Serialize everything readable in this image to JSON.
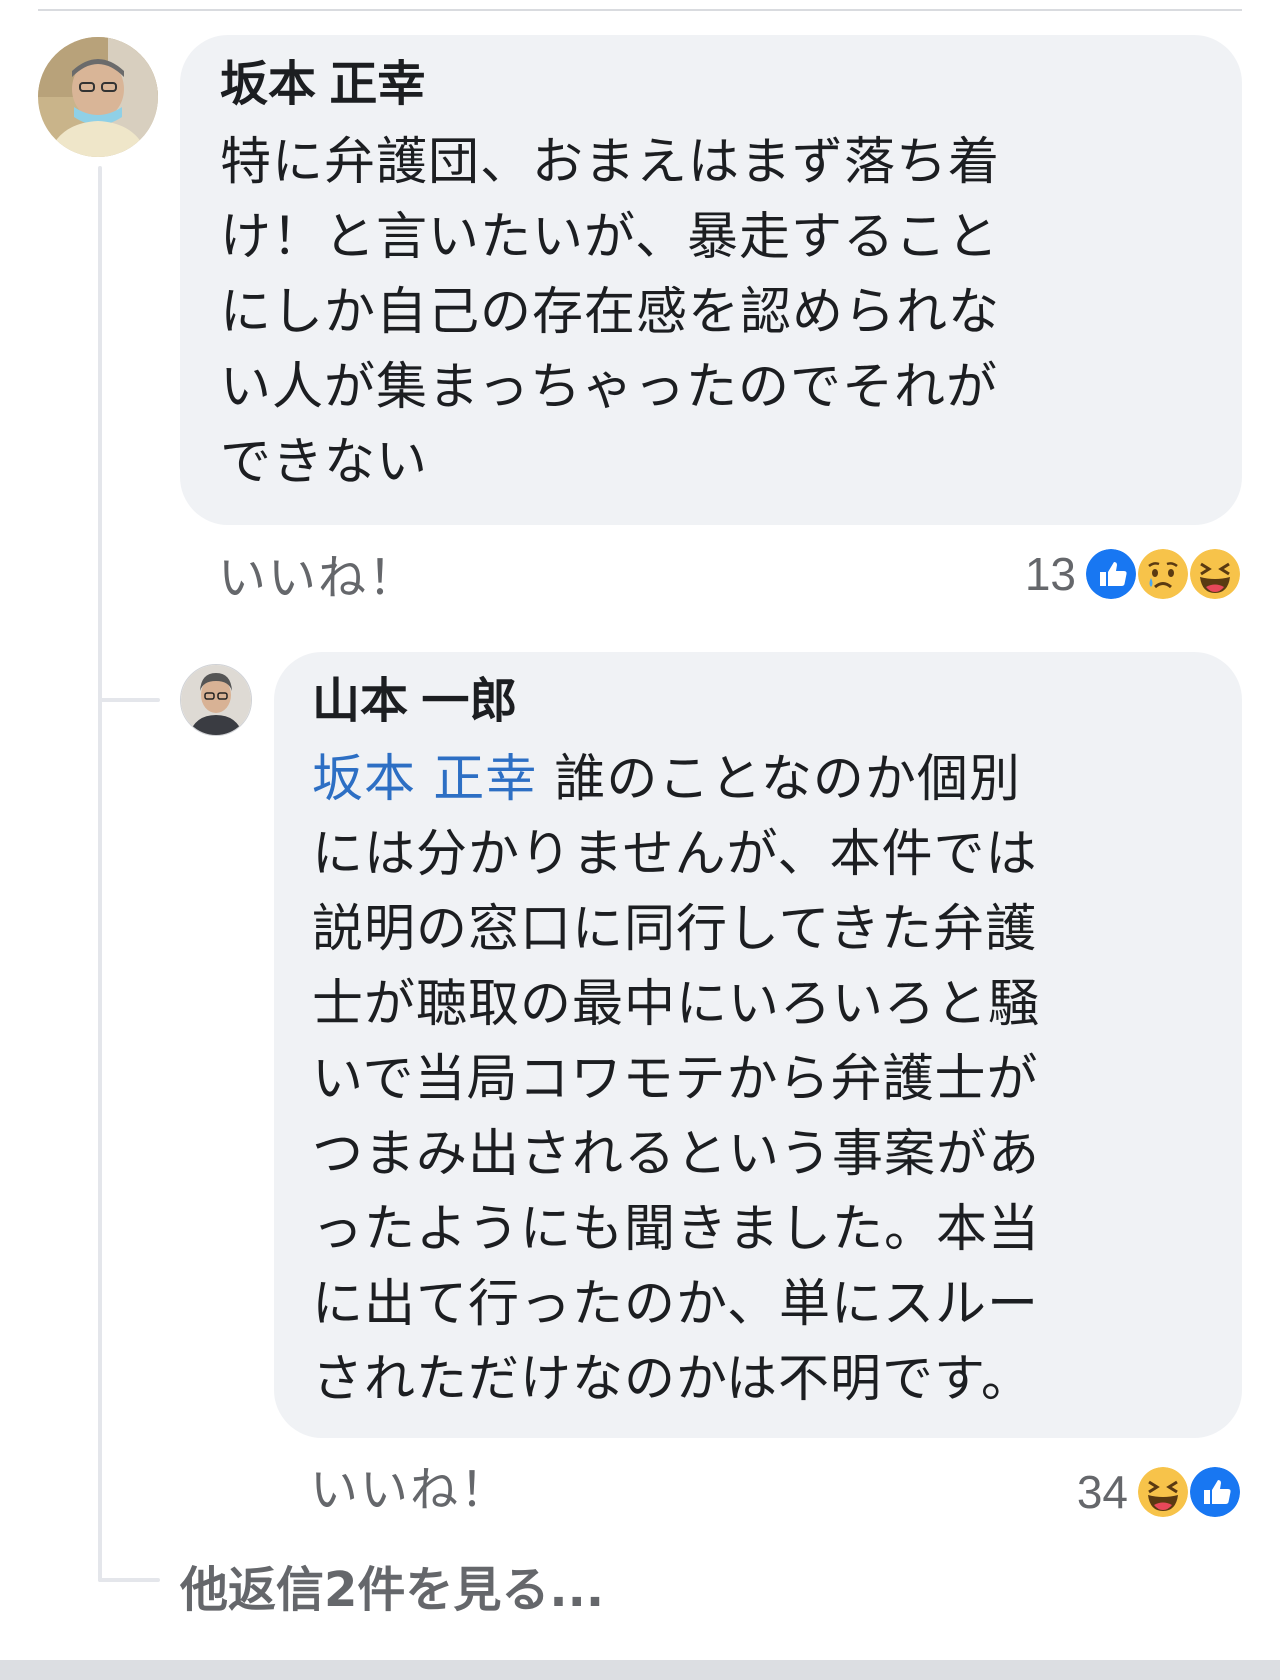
{
  "comment": {
    "author": "坂本 正幸",
    "lines": [
      "特に弁護団、おまえはまず落ち着",
      "け！と言いたいが、暴走すること",
      "にしか自己の存在感を認められな",
      "い人が集まっちゃったのでそれが",
      "できない"
    ],
    "like_label": "いいね！",
    "reaction_count": "13",
    "reaction_icons": [
      "like-icon",
      "sad-icon",
      "haha-icon"
    ]
  },
  "reply": {
    "author": "山本 一郎",
    "mention": "坂本 正幸",
    "first_line_rest": " 誰のことなのか個別",
    "lines": [
      "には分かりませんが、本件では",
      "説明の窓口に同行してきた弁護",
      "士が聴取の最中にいろいろと騒",
      "いで当局コワモテから弁護士が",
      "つまみ出されるという事案があ",
      "ったようにも聞きました。本当",
      "に出て行ったのか、単にスルー",
      "されただけなのかは不明です。"
    ],
    "like_label": "いいね！",
    "reaction_count": "34",
    "reaction_icons": [
      "haha-icon",
      "like-icon"
    ]
  },
  "more_replies": "他返信2件を見る...",
  "colors": {
    "bubble": "#f0f2f5",
    "mention": "#2d6fc4",
    "secondary_text": "#65676b",
    "like_blue": "#1877f2"
  }
}
